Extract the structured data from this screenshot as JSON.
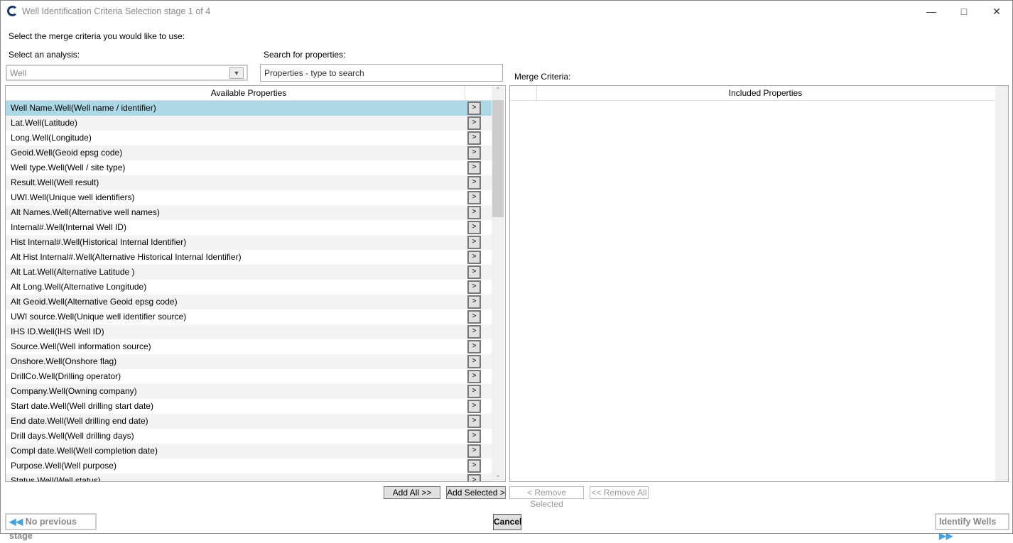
{
  "window": {
    "title": "Well Identification Criteria Selection stage 1 of 4"
  },
  "instructions": "Select the merge criteria you would like to use:",
  "analysis": {
    "label": "Select an analysis:",
    "value": "Well"
  },
  "search": {
    "label": "Search for properties:",
    "placeholder": "Properties - type to search"
  },
  "merge_label": "Merge Criteria:",
  "available": {
    "header": "Available Properties",
    "add_glyph": ">",
    "items": [
      "Well Name.Well(Well name / identifier)",
      "Lat.Well(Latitude)",
      "Long.Well(Longitude)",
      "Geoid.Well(Geoid epsg code)",
      "Well type.Well(Well / site type)",
      "Result.Well(Well result)",
      "UWI.Well(Unique well identifiers)",
      "Alt Names.Well(Alternative well names)",
      "Internal#.Well(Internal Well ID)",
      "Hist Internal#.Well(Historical Internal Identifier)",
      "Alt Hist Internal#.Well(Alternative Historical Internal Identifier)",
      "Alt Lat.Well(Alternative Latitude )",
      "Alt Long.Well(Alternative Longitude)",
      "Alt Geoid.Well(Alternative Geoid epsg code)",
      "UWI source.Well(Unique well identifier source)",
      "IHS ID.Well(IHS Well ID)",
      "Source.Well(Well information source)",
      "Onshore.Well(Onshore flag)",
      "DrillCo.Well(Drilling operator)",
      "Company.Well(Owning company)",
      "Start date.Well(Well drilling start date)",
      "End date.Well(Well drilling end date)",
      "Drill days.Well(Well drilling days)",
      "Compl date.Well(Well completion date)",
      "Purpose.Well(Well purpose)",
      "Status.Well(Well status)"
    ],
    "selected_index": 0
  },
  "included": {
    "header": "Included Properties",
    "items": []
  },
  "buttons": {
    "add_all": "Add All >>",
    "add_selected": "Add Selected >",
    "remove_selected": "< Remove Selected",
    "remove_all": "<< Remove All",
    "previous": "No previous stage",
    "cancel": "Cancel",
    "next": "Identify Wells"
  },
  "colors": {
    "selection": "#add8e6",
    "nav_icon": "#4aa3df"
  }
}
